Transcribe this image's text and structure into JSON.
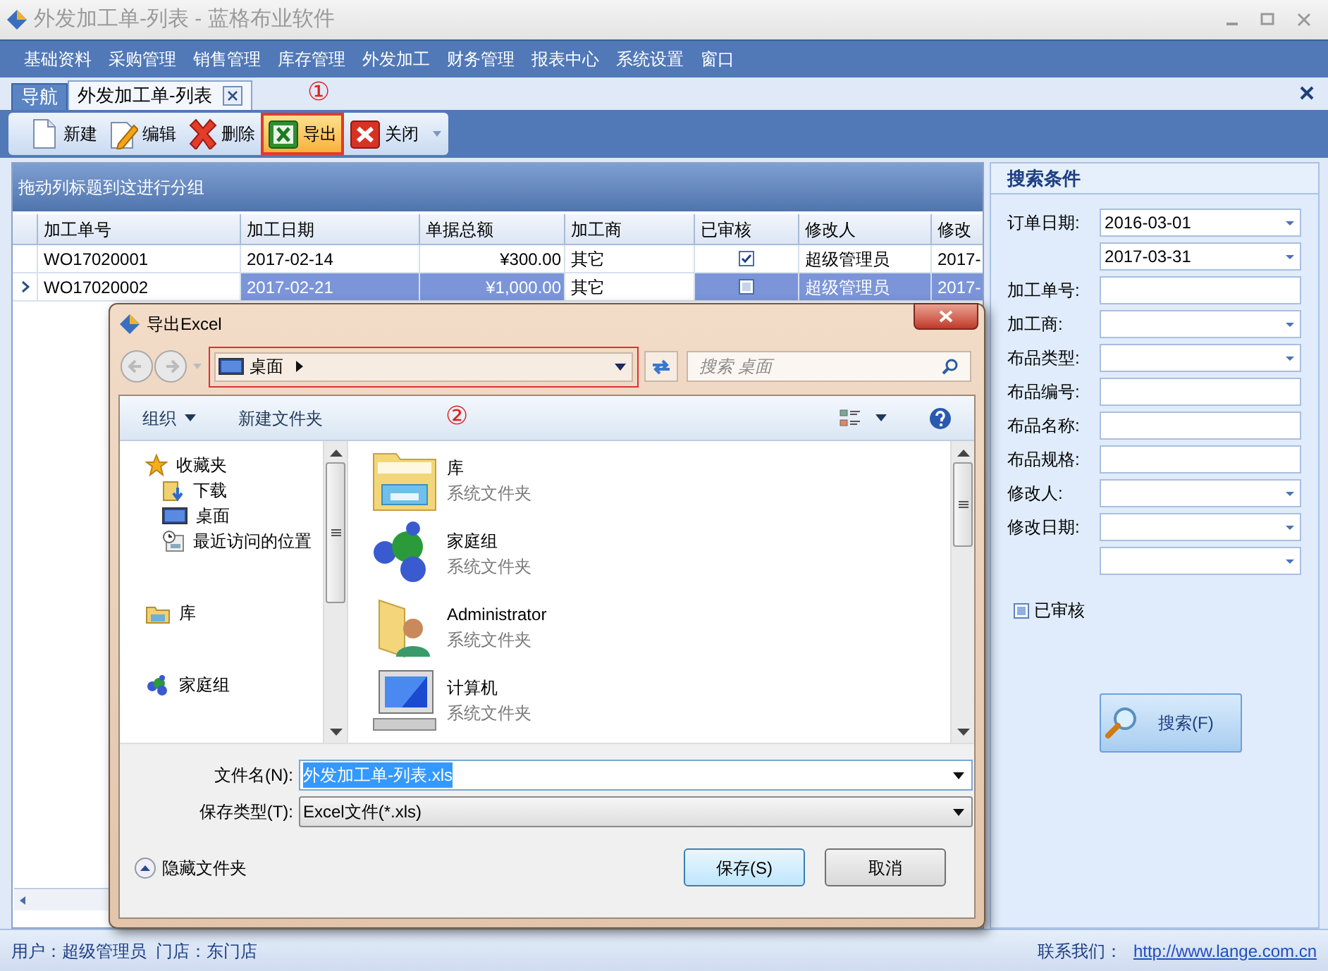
{
  "window": {
    "title": "外发加工单-列表 - 蓝格布业软件"
  },
  "menu": [
    "基础资料",
    "采购管理",
    "销售管理",
    "库存管理",
    "外发加工",
    "财务管理",
    "报表中心",
    "系统设置",
    "窗口"
  ],
  "tabs": [
    {
      "label": "导航",
      "selected": false,
      "closable": false
    },
    {
      "label": "外发加工单-列表",
      "selected": true,
      "closable": true
    }
  ],
  "toolbar": [
    {
      "kind": "new",
      "label": "新建",
      "highlighted": false
    },
    {
      "kind": "edit",
      "label": "编辑",
      "highlighted": false
    },
    {
      "kind": "delete",
      "label": "删除",
      "highlighted": false
    },
    {
      "kind": "export",
      "label": "导出",
      "highlighted": true
    },
    {
      "kind": "close",
      "label": "关闭",
      "highlighted": false
    }
  ],
  "annotations": [
    "①",
    "②"
  ],
  "grid": {
    "group_hint": "拖动列标题到这进行分组",
    "columns": [
      "加工单号",
      "加工日期",
      "单据总额",
      "加工商",
      "已审核",
      "修改人",
      "修改"
    ],
    "rows": [
      {
        "selected": false,
        "cells": [
          "WO17020001",
          "2017-02-14",
          "¥300.00",
          "其它",
          "",
          "超级管理员",
          "2017-"
        ],
        "checked": true
      },
      {
        "selected": true,
        "cells": [
          "WO17020002",
          "2017-02-21",
          "¥1,000.00",
          "其它",
          "",
          "超级管理员",
          "2017-"
        ],
        "checked": false
      }
    ]
  },
  "search_panel": {
    "title": "搜索条件",
    "fields": [
      {
        "kind": "dropdown",
        "label": "订单日期:",
        "value": "2016-03-01"
      },
      {
        "kind": "dropdown",
        "value": "2017-03-31"
      },
      {
        "kind": "text",
        "label": "加工单号:"
      },
      {
        "kind": "dropdown",
        "label": "加工商:"
      },
      {
        "kind": "dropdown",
        "label": "布品类型:"
      },
      {
        "kind": "text",
        "label": "布品编号:"
      },
      {
        "kind": "text",
        "label": "布品名称:"
      },
      {
        "kind": "text",
        "label": "布品规格:"
      },
      {
        "kind": "dropdown",
        "label": "修改人:"
      },
      {
        "kind": "dropdown",
        "label": "修改日期:"
      },
      {
        "kind": "dropdown"
      }
    ],
    "checkbox": {
      "label": "已审核",
      "checked": false
    },
    "button": "搜索(F)"
  },
  "dialog": {
    "title": "导出Excel",
    "location": "桌面",
    "search_placeholder": "搜索 桌面",
    "toolbar": [
      "组织",
      "新建文件夹"
    ],
    "nav": [
      {
        "kind": "star",
        "label": "收藏夹",
        "children": [
          {
            "kind": "download",
            "label": "下载"
          },
          {
            "kind": "desktop",
            "label": "桌面"
          },
          {
            "kind": "recent",
            "label": "最近访问的位置"
          }
        ]
      },
      {
        "kind": "library",
        "label": "库"
      },
      {
        "kind": "homegroup",
        "label": "家庭组"
      }
    ],
    "files": [
      {
        "kind": "library",
        "name": "库",
        "type": "系统文件夹"
      },
      {
        "kind": "homegroup",
        "name": "家庭组",
        "type": "系统文件夹"
      },
      {
        "kind": "user",
        "name": "Administrator",
        "type": "系统文件夹"
      },
      {
        "kind": "computer",
        "name": "计算机",
        "type": "系统文件夹"
      }
    ],
    "filename_label": "文件名(N):",
    "filename": "外发加工单-列表.xls",
    "type_label": "保存类型(T):",
    "type": "Excel文件(*.xls)",
    "hide_folders": "隐藏文件夹",
    "save": "保存(S)",
    "cancel": "取消"
  },
  "status_bar": {
    "user": "用户：超级管理员  门店：东门店",
    "contact_label": "联系我们：",
    "link": "http://www.lange.com.cn"
  }
}
